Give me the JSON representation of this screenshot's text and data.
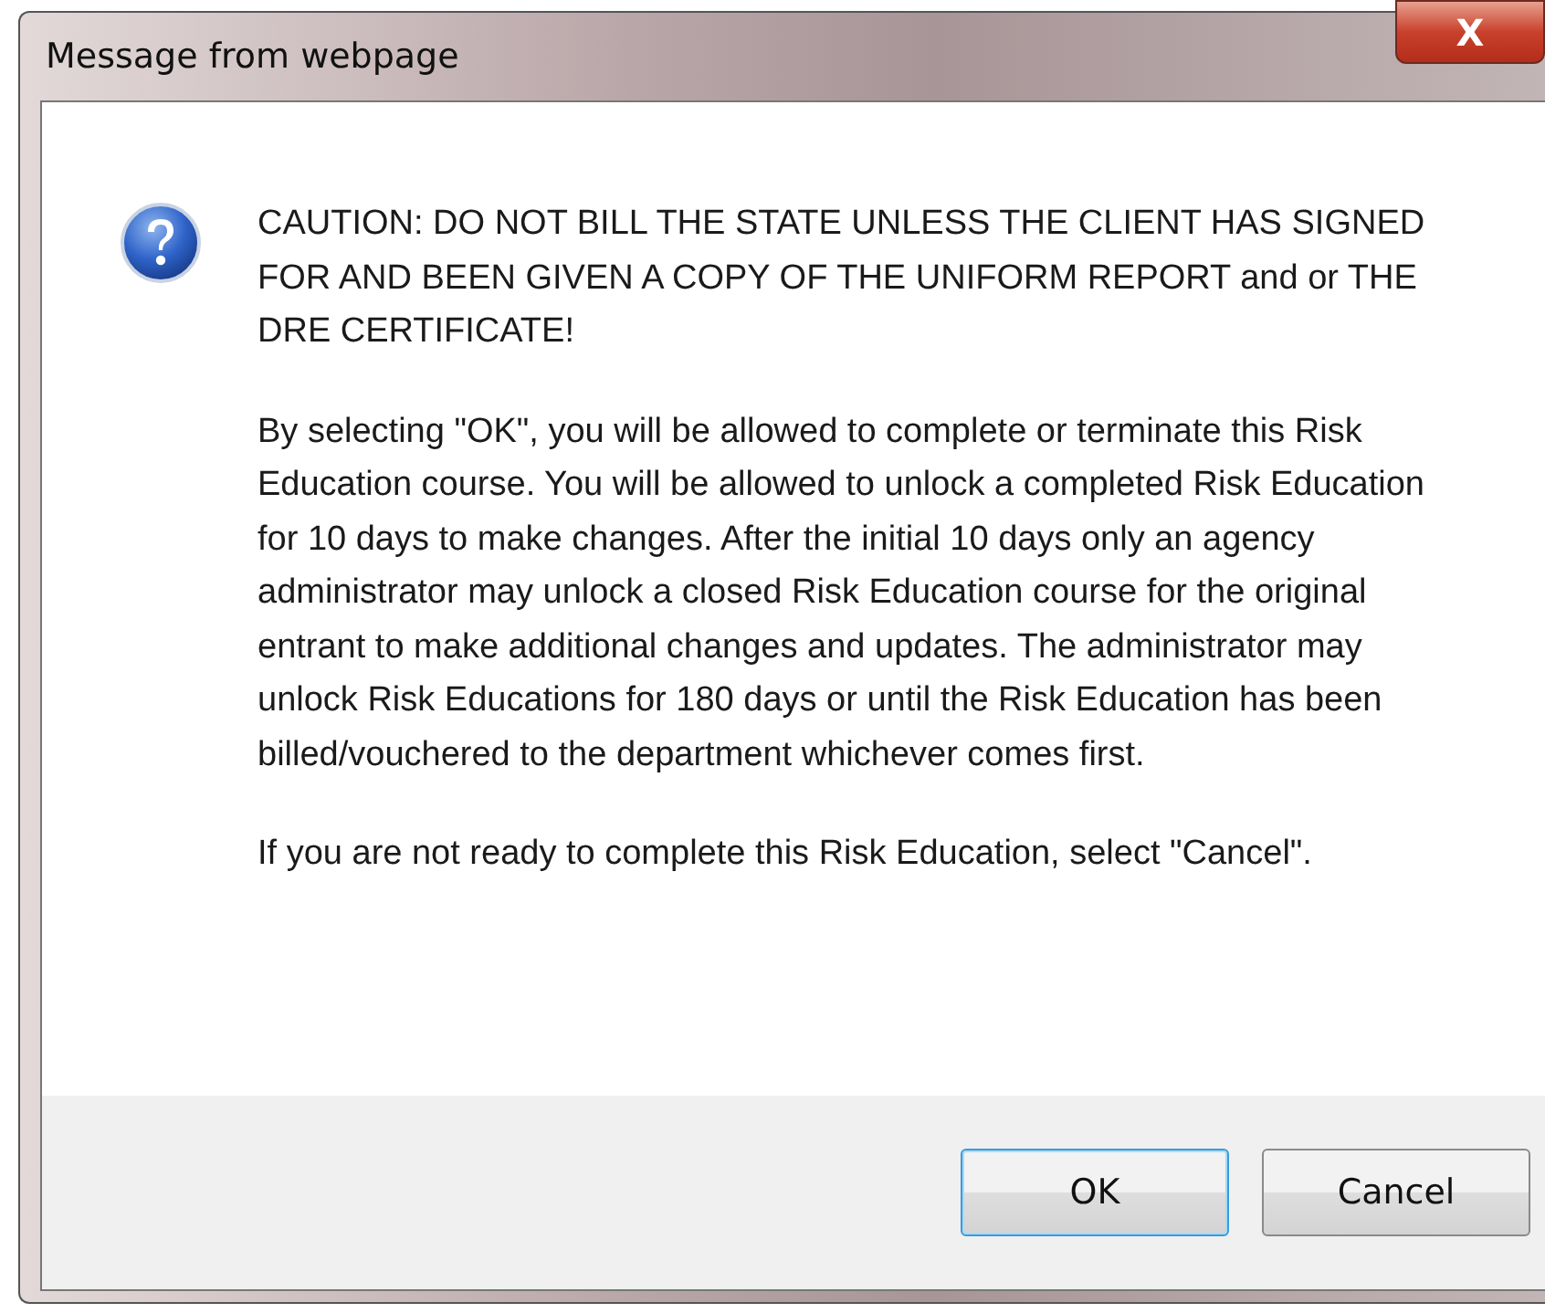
{
  "window": {
    "title": "Message from webpage",
    "close": "X"
  },
  "message": {
    "paragraphs": [
      "CAUTION: DO NOT BILL THE STATE UNLESS THE CLIENT HAS SIGNED FOR AND BEEN GIVEN A COPY OF THE UNIFORM REPORT and or THE DRE CERTIFICATE!",
      "By selecting \"OK\", you will be allowed to complete or terminate this Risk Education course. You will be allowed to unlock a completed Risk Education for 10 days to make changes. After the initial 10 days only an agency administrator may unlock a closed Risk Education course for the original entrant to make additional changes and updates. The administrator may unlock Risk Educations for 180 days or until the Risk Education has been billed/vouchered to the department whichever comes first.",
      "If you are not ready to complete this Risk Education, select \"Cancel\"."
    ]
  },
  "buttons": [
    {
      "label": "OK",
      "focused": true
    },
    {
      "label": "Cancel",
      "focused": false
    }
  ]
}
